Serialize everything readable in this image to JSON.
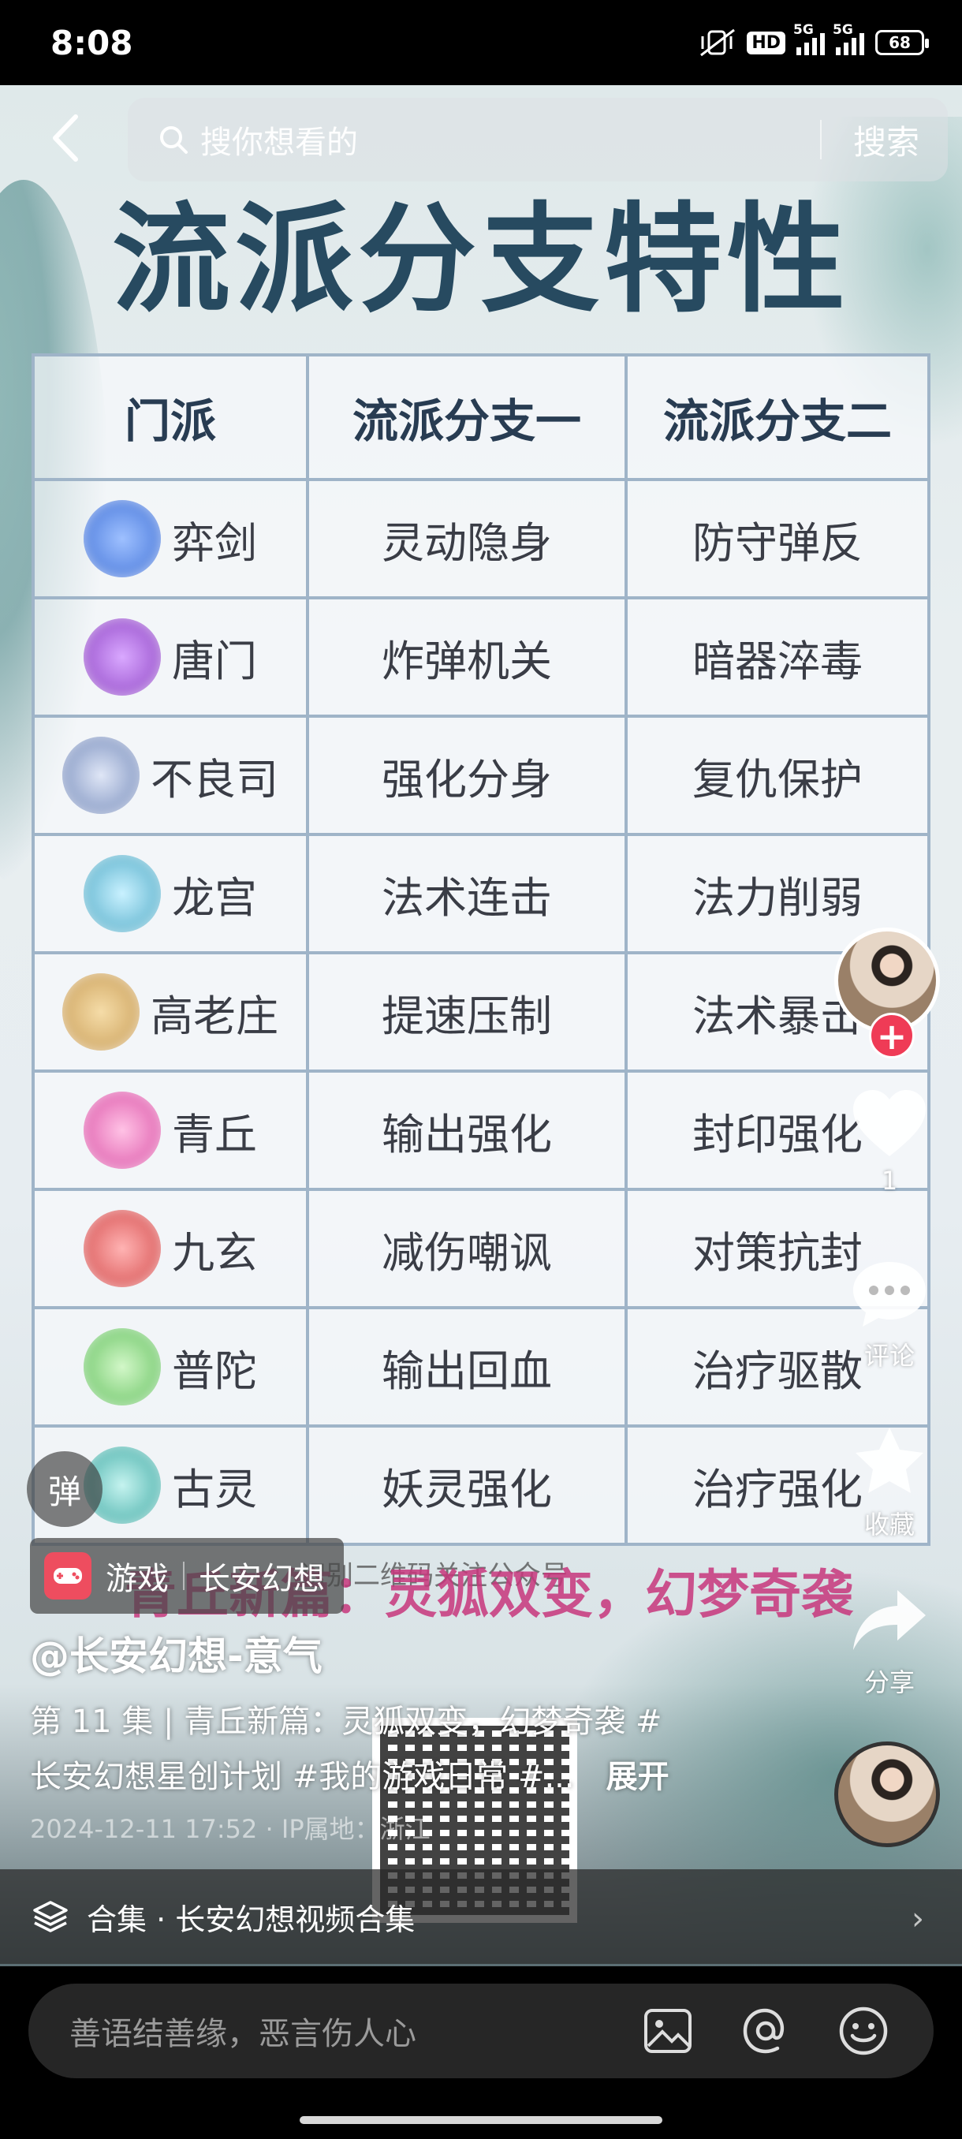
{
  "status_bar": {
    "time": "8:08",
    "hd": "HD",
    "net1": "5G",
    "net2": "5G",
    "battery": "68"
  },
  "search": {
    "placeholder": "搜你想看的",
    "button": "搜索"
  },
  "poster": {
    "title": "流派分支特性",
    "headers": [
      "门派",
      "流派分支一",
      "流派分支二"
    ],
    "rows": [
      {
        "sect": "弈剑",
        "branch1": "灵动隐身",
        "branch2": "防守弹反",
        "color": "#3d6fd6"
      },
      {
        "sect": "唐门",
        "branch1": "炸弹机关",
        "branch2": "暗器淬毒",
        "color": "#8b3fc2"
      },
      {
        "sect": "不良司",
        "branch1": "强化分身",
        "branch2": "复仇保护",
        "color": "#6f86b8"
      },
      {
        "sect": "龙宫",
        "branch1": "法术连击",
        "branch2": "法力削弱",
        "color": "#49a7c4"
      },
      {
        "sect": "高老庄",
        "branch1": "提速压制",
        "branch2": "法术暴击",
        "color": "#c79a52"
      },
      {
        "sect": "青丘",
        "branch1": "输出强化",
        "branch2": "封印强化",
        "color": "#d94ba3"
      },
      {
        "sect": "九玄",
        "branch1": "减伤嘲讽",
        "branch2": "对策抗封",
        "color": "#d24545"
      },
      {
        "sect": "普陀",
        "branch1": "输出回血",
        "branch2": "治疗驱散",
        "color": "#5fbf5a"
      },
      {
        "sect": "古灵",
        "branch1": "妖灵强化",
        "branch2": "治疗强化",
        "color": "#3aa8a2"
      }
    ],
    "banner": "青丘新篇：灵狐双变，幻梦奇袭",
    "qr_note": "识别二维码关注公众号"
  },
  "rail": {
    "like_count": "1",
    "comment_label": "评论",
    "favorite_label": "收藏",
    "share_label": "分享"
  },
  "danmu": "弹",
  "tag": {
    "category": "游戏",
    "game": "长安幻想"
  },
  "author": "@长安幻想-意气",
  "description": {
    "line1": "第 11 集 | 青丘新篇：灵狐双变，幻梦奇袭 #",
    "line2": "长安幻想星创计划 #我的游戏日常 #...",
    "expand": "展开"
  },
  "meta": "2024-12-11 17:52 · IP属地：浙江",
  "collection": "合集 · 长安幻想视频合集",
  "comment_box": {
    "placeholder": "善语结善缘，恶言伤人心"
  },
  "colors": {
    "follow_red": "#ef3b56",
    "game_red": "#ee4d5f",
    "title_blue": "#274a60",
    "banner_pink": "#c8377d"
  }
}
